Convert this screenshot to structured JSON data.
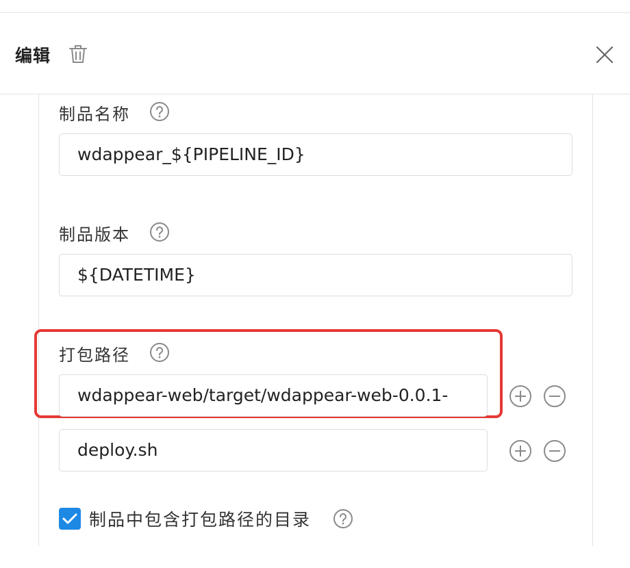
{
  "header": {
    "title": "编辑"
  },
  "icons": {
    "delete": "trash-icon",
    "close": "close-icon",
    "help": "question-circle-icon",
    "add": "plus-circle-icon",
    "remove": "minus-circle-icon",
    "check": "checkmark-icon"
  },
  "fields": {
    "artifact_name": {
      "label": "制品名称",
      "value": "wdappear_${PIPELINE_ID}"
    },
    "artifact_version": {
      "label": "制品版本",
      "value": "${DATETIME}"
    },
    "package_paths": {
      "label": "打包路径",
      "items": [
        "wdappear-web/target/wdappear-web-0.0.1-",
        "deploy.sh"
      ]
    },
    "include_dir": {
      "label": "制品中包含打包路径的目录",
      "checked": true
    }
  },
  "colors": {
    "highlight": "#e53935",
    "checkbox": "#1e88e5",
    "icon_gray": "#8a8a8a"
  }
}
